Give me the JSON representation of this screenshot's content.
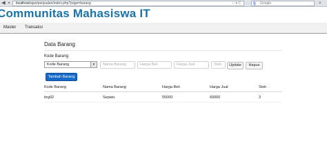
{
  "browser": {
    "url_host": "localhost",
    "url_path": "/ajax/penjualan/index.php?page=barang",
    "url_tools": "☆ ▾ C",
    "search_placeholder": "Google"
  },
  "site": {
    "title": "Communitas Mahasiswa IT"
  },
  "menu": {
    "items": [
      {
        "label": "Master"
      },
      {
        "label": "Transaksi"
      }
    ]
  },
  "panel": {
    "title": "Data Barang",
    "kode_label": "Kode Barang",
    "kode_select_value": "Kode Barang",
    "fields": {
      "nama_placeholder": "Nama Barang",
      "harga_beli_placeholder": "Harga Beli",
      "harga_jual_placeholder": "Harga Jual",
      "stok_placeholder": "Stok"
    },
    "buttons": {
      "update": "Update",
      "hapus": "Hapus",
      "tambah": "Tambah Barang"
    }
  },
  "table": {
    "headers": [
      "Kode Barang",
      "Nama Barang",
      "Harga Beli",
      "Harga Jual",
      "Stok"
    ],
    "rows": [
      [
        "brg02",
        "Sepatu",
        "55000",
        "60000",
        "3"
      ]
    ]
  }
}
